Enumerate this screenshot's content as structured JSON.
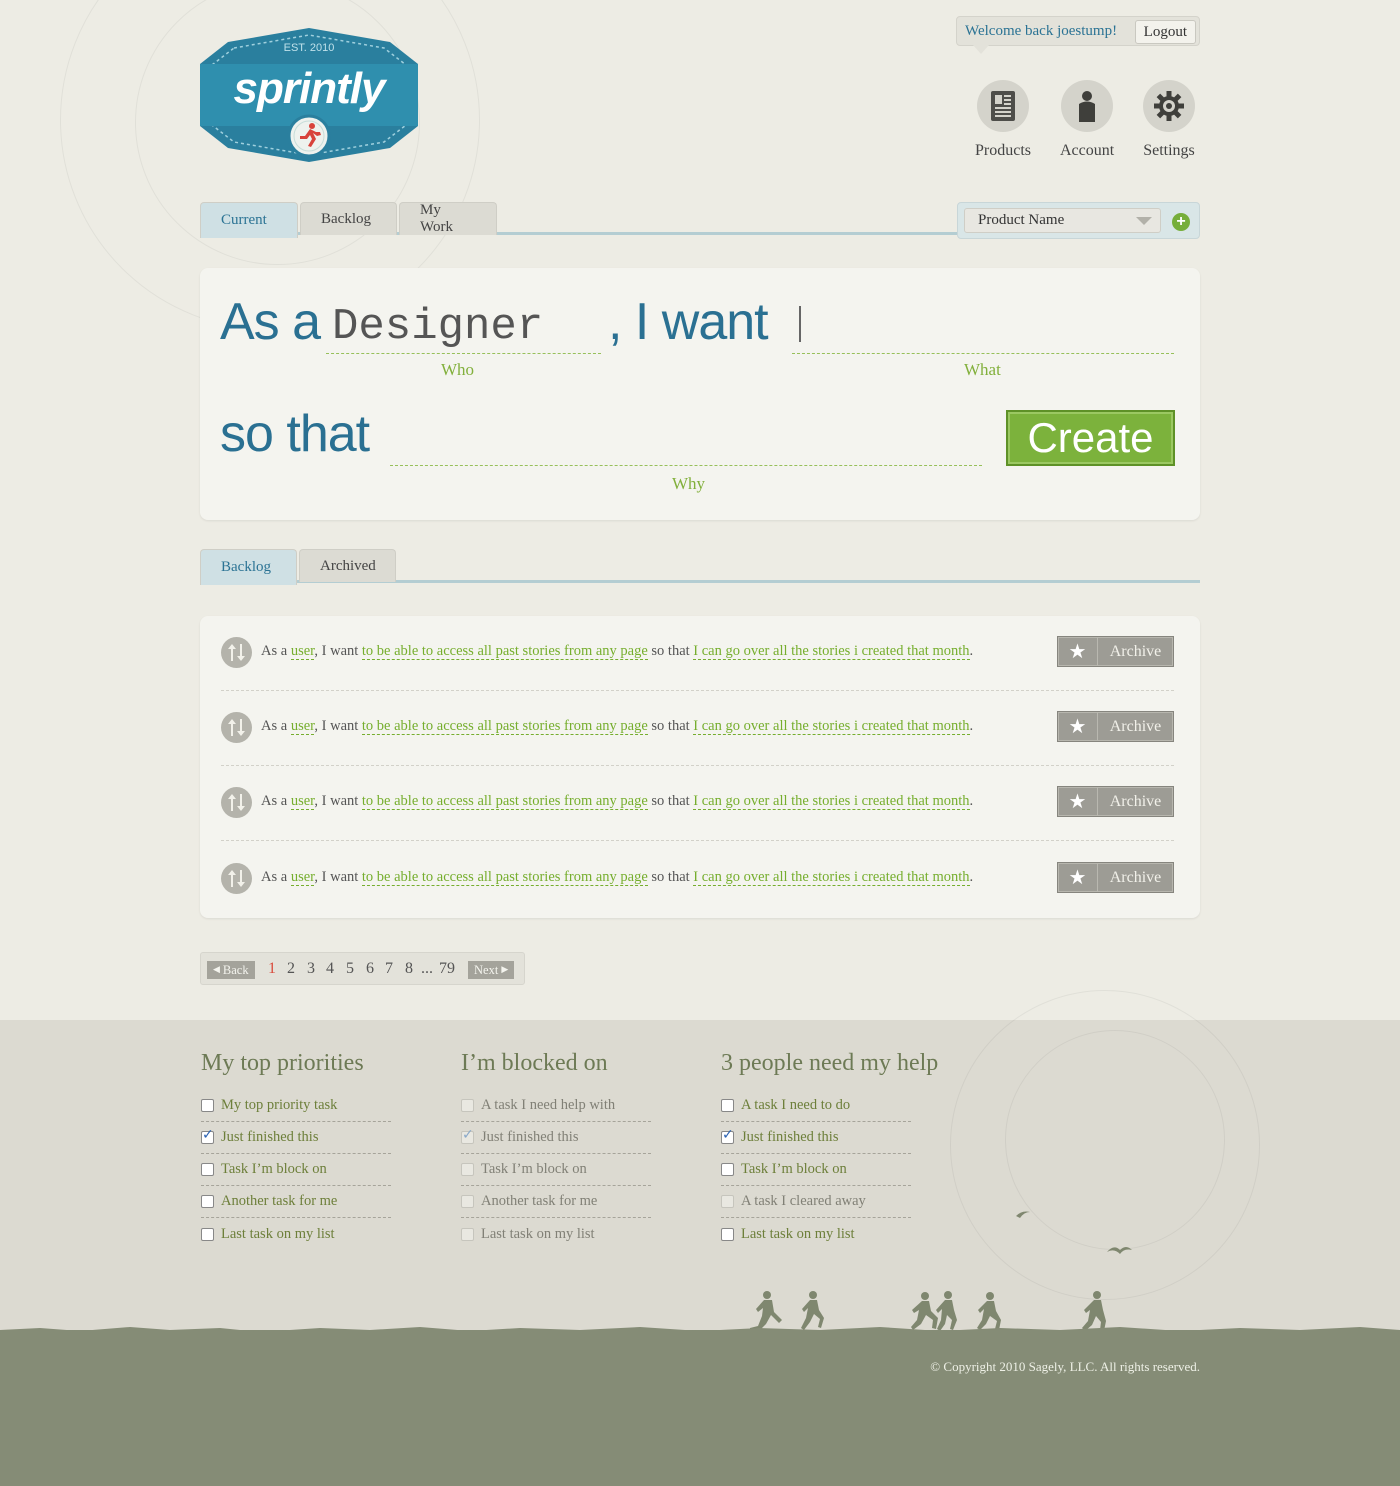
{
  "header": {
    "welcome_text": "Welcome back joestump!",
    "logout_label": "Logout",
    "logo": {
      "brand": "sprintly",
      "est": "EST. 2010"
    },
    "nav": [
      {
        "label": "Products",
        "icon": "products-icon"
      },
      {
        "label": "Account",
        "icon": "account-icon"
      },
      {
        "label": "Settings",
        "icon": "gear-icon"
      }
    ]
  },
  "main_tabs": [
    {
      "label": "Current",
      "active": true
    },
    {
      "label": "Backlog",
      "active": false
    },
    {
      "label": "My Work",
      "active": false
    }
  ],
  "product_select": {
    "value": "Product Name"
  },
  "story_form": {
    "as_a": "As a",
    "who_value": "Designer",
    "i_want": ", I want",
    "so_that": "so that",
    "who_label": "Who",
    "what_label": "What",
    "why_label": "Why",
    "what_value": "",
    "why_value": "",
    "create_label": "Create"
  },
  "list_tabs": [
    {
      "label": "Backlog",
      "active": true
    },
    {
      "label": "Archived",
      "active": false
    }
  ],
  "stories": [
    {
      "as_a": "As a",
      "who": "user",
      "i_want": ", I want",
      "what": "to be able to access all past stories from any page",
      "so_that": "so that",
      "why": "I can go over all the stories i created that month",
      "end": ".",
      "action": "Archive"
    },
    {
      "as_a": "As a",
      "who": "user",
      "i_want": ", I want",
      "what": "to be able to access all past stories from any page",
      "so_that": "so that",
      "why": "I can go over all the stories i created that month",
      "end": ".",
      "action": "Archive"
    },
    {
      "as_a": "As a",
      "who": "user",
      "i_want": ", I want",
      "what": "to be able to access all past stories from any page",
      "so_that": "so that",
      "why": "I can go over all the stories i created that month",
      "end": ".",
      "action": "Archive"
    },
    {
      "as_a": "As a",
      "who": "user",
      "i_want": ", I want",
      "what": "to be able to access all past stories from any page",
      "so_that": "so that",
      "why": "I can go over all the stories i created that month",
      "end": ".",
      "action": "Archive"
    }
  ],
  "pagination": {
    "back_label": "Back",
    "next_label": "Next",
    "pages": [
      "1",
      "2",
      "3",
      "4",
      "5",
      "6",
      "7",
      "8",
      "...",
      "79"
    ],
    "current": "1"
  },
  "footer": {
    "columns": [
      {
        "title": "My top priorities",
        "items": [
          {
            "text": "My top priority task",
            "checked": false,
            "dim": false
          },
          {
            "text": "Just finished this",
            "checked": true,
            "dim": false
          },
          {
            "text": "Task I’m block on",
            "checked": false,
            "dim": false
          },
          {
            "text": "Another task for me",
            "checked": false,
            "dim": false
          },
          {
            "text": "Last task on my list",
            "checked": false,
            "dim": false
          }
        ]
      },
      {
        "title": "I’m blocked on",
        "items": [
          {
            "text": "A task I need help with",
            "checked": false,
            "dim": true
          },
          {
            "text": "Just finished this",
            "checked": true,
            "dim": true
          },
          {
            "text": "Task I’m block on",
            "checked": false,
            "dim": true
          },
          {
            "text": "Another task for me",
            "checked": false,
            "dim": true
          },
          {
            "text": "Last task on my list",
            "checked": false,
            "dim": true
          }
        ]
      },
      {
        "title": "3 people need my help",
        "items": [
          {
            "text": "A task I need to do",
            "checked": false,
            "dim": false
          },
          {
            "text": "Just finished this",
            "checked": true,
            "dim": false
          },
          {
            "text": "Task I’m block on",
            "checked": false,
            "dim": false
          },
          {
            "text": "A task I cleared away",
            "checked": false,
            "dim": true
          },
          {
            "text": "Last task on my list",
            "checked": false,
            "dim": false
          }
        ]
      }
    ],
    "copyright": "© Copyright 2010 Sagely, LLC. All rights reserved."
  },
  "colors": {
    "brand_blue": "#2a7092",
    "accent_green": "#7cb23c",
    "ground": "#858c76"
  }
}
